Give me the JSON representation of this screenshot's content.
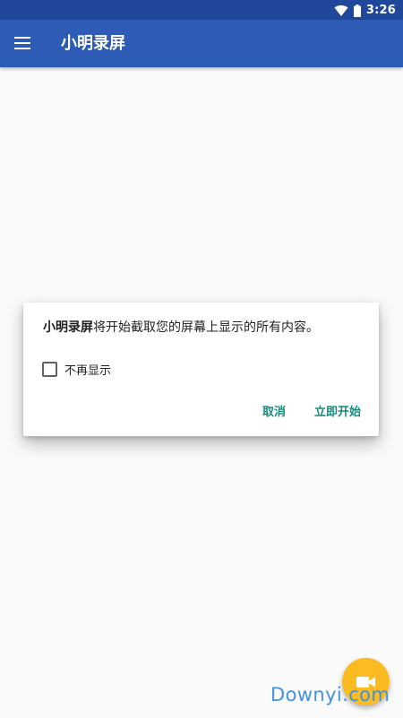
{
  "status_bar": {
    "time": "3:26",
    "icons": [
      "wifi-icon",
      "battery-icon"
    ]
  },
  "app_bar": {
    "title": "小明录屏",
    "nav_icon": "menu-icon"
  },
  "dialog": {
    "app_name": "小明录屏",
    "message": "将开始截取您的屏幕上显示的所有内容。",
    "checkbox_label": "不再显示",
    "checkbox_checked": false,
    "cancel_label": "取消",
    "confirm_label": "立即开始"
  },
  "fab": {
    "icon": "video-camera-icon"
  },
  "watermark": {
    "text": "Downyi.com"
  },
  "colors": {
    "status_bar": "#21479a",
    "app_bar": "#2d5bb5",
    "dialog_button": "#168a7c",
    "fab": "#fbbc22",
    "watermark": "#3a8ede"
  }
}
